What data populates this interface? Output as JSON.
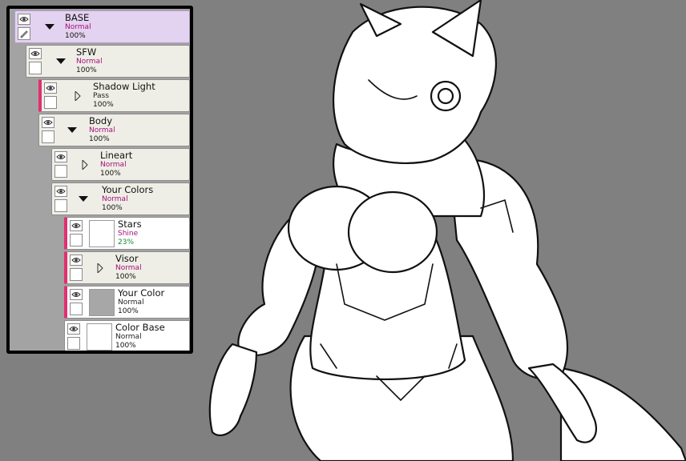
{
  "colors": {
    "canvas_bg": "#808080",
    "selected_layer": "#e3d2f0",
    "layer_bg": "#efeee6",
    "clip_bar": "#e0306f",
    "blend_mode_text": "#a3107a",
    "shine_text": "#138a35"
  },
  "icons": {
    "eye": "eye-icon",
    "pen": "pen-icon",
    "expanded": "triangle-down-icon",
    "collapsed": "triangle-right-icon"
  },
  "layers": [
    {
      "name": "BASE",
      "mode": "Normal",
      "opacity": "100%",
      "folder": "expanded",
      "selected": true
    },
    {
      "name": "SFW",
      "mode": "Normal",
      "opacity": "100%",
      "folder": "expanded"
    },
    {
      "name": "Shadow Light",
      "mode": "Pass",
      "opacity": "100%",
      "folder": "collapsed"
    },
    {
      "name": "Body",
      "mode": "Normal",
      "opacity": "100%",
      "folder": "expanded"
    },
    {
      "name": "Lineart",
      "mode": "Normal",
      "opacity": "100%",
      "folder": "collapsed"
    },
    {
      "name": "Your Colors",
      "mode": "Normal",
      "opacity": "100%",
      "folder": "expanded"
    },
    {
      "name": "Stars",
      "mode": "Shine",
      "opacity": "23%"
    },
    {
      "name": "Visor",
      "mode": "Normal",
      "opacity": "100%",
      "folder": "collapsed"
    },
    {
      "name": "Your Color",
      "mode": "Normal",
      "opacity": "100%"
    },
    {
      "name": "Color Base",
      "mode": "Normal",
      "opacity": "100%"
    }
  ]
}
